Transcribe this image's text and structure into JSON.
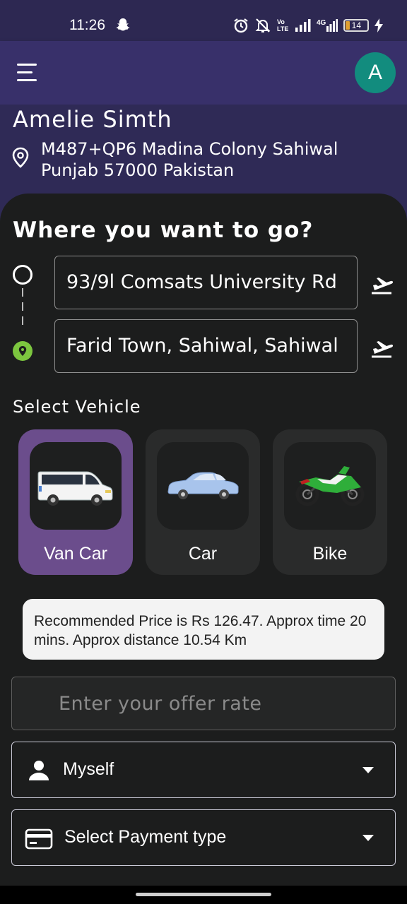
{
  "status_bar": {
    "time": "11:26",
    "network_label": "Vo LTE",
    "network_type": "4G",
    "battery_level": "14",
    "icons": [
      "snapchat-icon",
      "alarm-icon",
      "mute-icon",
      "signal-icon",
      "signal-4g-icon",
      "battery-icon",
      "charging-icon"
    ]
  },
  "app_bar": {
    "avatar_initial": "A",
    "avatar_color": "#128c7e"
  },
  "user": {
    "name": "Amelie Simth",
    "address": "M487+QP6 Madina Colony Sahiwal Punjab 57000 Pakistan"
  },
  "trip": {
    "title": "Where you want to go?",
    "from": "93/9l Comsats University Rd",
    "to": "Farid Town, Sahiwal, Sahiwal"
  },
  "vehicles": {
    "label": "Select Vehicle",
    "items": [
      {
        "label": "Van Car",
        "selected": true,
        "icon": "van-icon"
      },
      {
        "label": "Car",
        "selected": false,
        "icon": "car-icon"
      },
      {
        "label": "Bike",
        "selected": false,
        "icon": "bike-icon"
      }
    ]
  },
  "estimate": {
    "text": "Recommended Price is Rs 126.47. Approx time 20 mins. Approx distance 10.54 Km"
  },
  "offer": {
    "placeholder": "Enter your offer rate",
    "value": ""
  },
  "passenger": {
    "selected": "Myself"
  },
  "payment": {
    "selected": "Select Payment type"
  },
  "colors": {
    "header_bg": "#2f2a56",
    "panel_bg": "#1c1d1d",
    "selected_vehicle": "#6b4d8c",
    "destination_marker": "#7cc63f"
  }
}
